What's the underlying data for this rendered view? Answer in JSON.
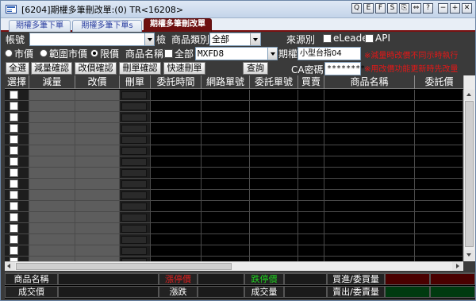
{
  "window": {
    "title": "[6204]期權多筆刪改單:(0) TR<16208>",
    "buttons": [
      "Q",
      "E",
      "F",
      "S",
      "⎘",
      "⇔",
      "?",
      "−",
      "+",
      "✕"
    ]
  },
  "tabs": [
    {
      "label": "期權多筆下單",
      "active": false
    },
    {
      "label": "期權多筆下單s",
      "active": false
    },
    {
      "label": "期權多筆刪改單",
      "active": true
    }
  ],
  "form": {
    "account_label": "帳號",
    "account_value": "",
    "check_button": "檢",
    "product_type_label": "商品類別",
    "product_type_value": "全部",
    "source_label": "來源別",
    "source_options": [
      "eLeader",
      "API"
    ],
    "price_types": [
      {
        "label": "市價",
        "selected": false
      },
      {
        "label": "範圍市價",
        "selected": false
      },
      {
        "label": "限價",
        "selected": true
      }
    ],
    "product_name_label": "商品名稱",
    "all_label": "全部",
    "product_code": "MXFD8",
    "expiry_label": "期權",
    "product_desc": "小型台指04",
    "buttons": [
      "全選",
      "減量確認",
      "改價確認",
      "刪單確認",
      "快速刪單"
    ],
    "query_button": "查詢",
    "ca_password_label": "CA密碼",
    "ca_password_value": "********",
    "warning_lines": [
      "※減量時改價不同示時執行",
      "※用改價功能更新時先改量"
    ]
  },
  "grid": {
    "columns": [
      "選擇",
      "減量",
      "改價",
      "刪單",
      "委託時間",
      "網路單號",
      "委託單號",
      "買賣",
      "商品名稱",
      "委託價"
    ],
    "row_count": 16
  },
  "quote_bar": {
    "product_name_label": "商品名稱",
    "limit_up_label": "漲停價",
    "limit_down_label": "跌停價",
    "bid_label": "買進/委買量",
    "last_price_label": "成交價",
    "change_label": "漲跌",
    "volume_label": "成交量",
    "ask_label": "賣出/委賣量"
  },
  "colors": {
    "tab_active": "#6d0f0f",
    "panel_bg": "#3a3a3a",
    "warning": "#e01818",
    "limit_up": "#e02020",
    "limit_down": "#20d020"
  }
}
